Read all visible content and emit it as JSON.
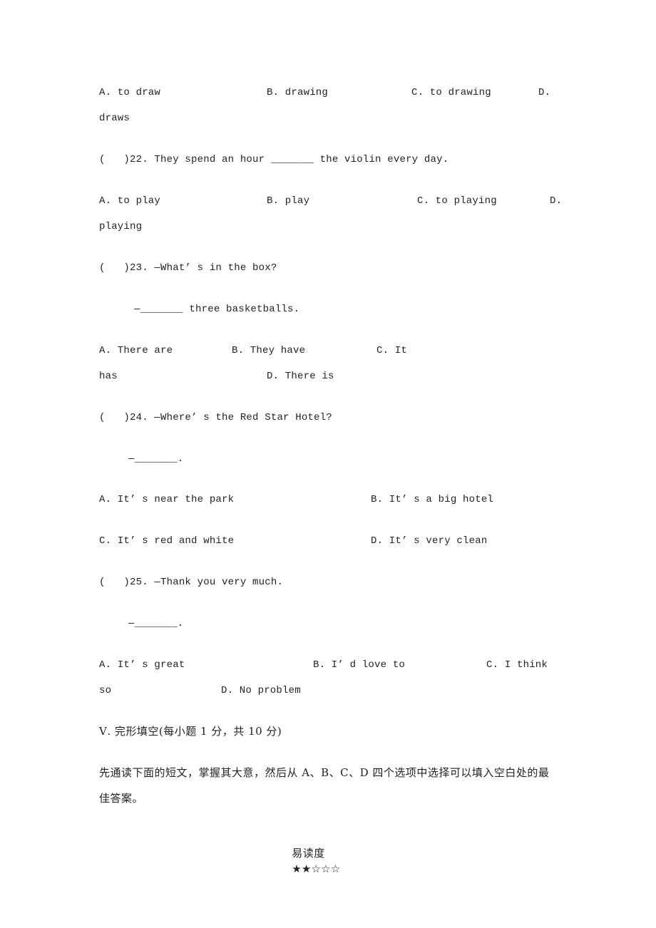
{
  "q21_options": {
    "a": "A. to draw",
    "b": "B. drawing",
    "c": "C. to drawing",
    "d_label": "D.",
    "d_text": "draws"
  },
  "q22": {
    "stem": "(   )22. They spend an hour _______ the violin every day.",
    "a": "A. to play",
    "b": "B. play",
    "c": "C. to playing",
    "d_label": "D.",
    "d_text": "playing"
  },
  "q23": {
    "stem": "(   )23. —What’ s in the box?",
    "answer_line": "—_______ three basketballs.",
    "a": "A. There are",
    "b": "B. They have",
    "c_label": "C. It",
    "c_text": "has",
    "d": "D. There is"
  },
  "q24": {
    "stem": "(   )24. —Where’ s the Red Star Hotel?",
    "answer_line": "—_______.",
    "a": "A. It’ s near the park",
    "b": "B. It’ s a big hotel",
    "c": "C. It’ s red and white",
    "d": "D. It’ s very clean"
  },
  "q25": {
    "stem": "(   )25. —Thank you very much.",
    "answer_line": "—_______.",
    "a": "A. It’ s great",
    "b": "B. I’ d love to",
    "c_label": "C. I think",
    "c_text": "so",
    "d": "D. No problem"
  },
  "section5": {
    "heading": "Ⅴ. 完形填空(每小题 1 分，共 10 分)",
    "instruction_line1": "先通读下面的短文，掌握其大意，然后从 A、B、C、D 四个选项中选择可以填入空白处的最",
    "instruction_line2": "佳答案。",
    "difficulty_label": "易读度",
    "difficulty_stars": "★★☆☆☆",
    "difficulty_rating": "2/5"
  }
}
